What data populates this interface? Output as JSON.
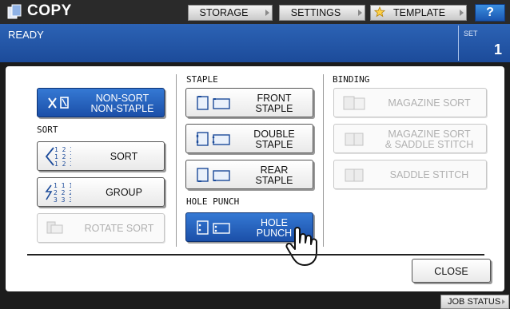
{
  "header": {
    "app_title": "COPY",
    "storage_label": "STORAGE",
    "settings_label": "SETTINGS",
    "template_label": "TEMPLATE",
    "help_label": "?"
  },
  "status": {
    "text": "READY",
    "set_label": "SET",
    "set_count": "1"
  },
  "panel": {
    "non_sort_label_1": "NON-SORT",
    "non_sort_label_2": "NON-STAPLE",
    "sort_section": "SORT",
    "sort_label": "SORT",
    "group_label": "GROUP",
    "rotate_sort_label": "ROTATE SORT",
    "staple_section": "STAPLE",
    "front_staple_1": "FRONT",
    "front_staple_2": "STAPLE",
    "double_staple_1": "DOUBLE",
    "double_staple_2": "STAPLE",
    "rear_staple_1": "REAR",
    "rear_staple_2": "STAPLE",
    "hole_punch_section": "HOLE PUNCH",
    "hole_punch_1": "HOLE",
    "hole_punch_2": "PUNCH",
    "binding_section": "BINDING",
    "magazine_sort_label": "MAGAZINE SORT",
    "mag_saddle_1": "MAGAZINE SORT",
    "mag_saddle_2": "& SADDLE STITCH",
    "saddle_stitch_label": "SADDLE STITCH",
    "sort_icon_digits": [
      "1 2 3",
      "1 2 3",
      "1 2 3"
    ],
    "group_icon_digits": [
      "1 1 1",
      "2 2 2",
      "3 3 3"
    ]
  },
  "footer": {
    "close_label": "CLOSE",
    "job_status_label": "JOB STATUS"
  },
  "colors": {
    "selected_button": "#2461bd",
    "status_bar": "#2257a8",
    "disabled_text": "#b0b0b0"
  }
}
